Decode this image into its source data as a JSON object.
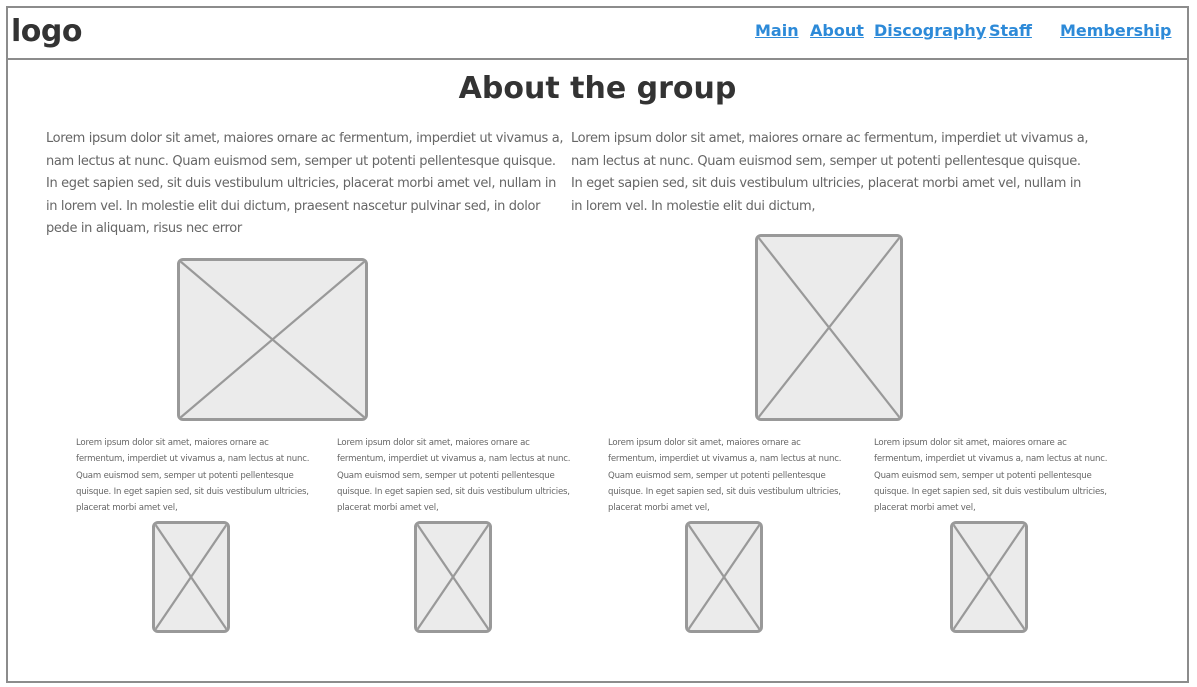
{
  "header": {
    "logo": "logo",
    "nav": [
      "Main",
      "About",
      "Discography",
      "Staff",
      "Membership"
    ]
  },
  "main": {
    "title": "About the group",
    "intro_left": "Lorem ipsum dolor sit amet, maiores ornare ac fermentum, imperdiet ut vivamus a, nam lectus at nunc. Quam euismod sem, semper ut potenti pellentesque quisque. In eget sapien sed, sit duis vestibulum ultricies, placerat morbi amet vel, nullam in in lorem vel. In molestie elit dui dictum, praesent nascetur pulvinar sed, in dolor pede in aliquam, risus nec error",
    "intro_right": "Lorem ipsum dolor sit amet, maiores ornare ac fermentum, imperdiet ut vivamus a, nam lectus at nunc. Quam euismod sem, semper ut potenti pellentesque quisque. In eget sapien sed, sit duis vestibulum ultricies, placerat morbi amet vel, nullam in in lorem vel. In molestie elit dui dictum,",
    "cards": [
      "Lorem ipsum dolor sit amet, maiores ornare ac fermentum, imperdiet ut vivamus a, nam lectus at nunc. Quam euismod sem, semper ut potenti pellentesque quisque. In eget sapien sed, sit duis vestibulum ultricies, placerat morbi amet vel,",
      "Lorem ipsum dolor sit amet, maiores ornare ac fermentum, imperdiet ut vivamus a, nam lectus at nunc. Quam euismod sem, semper ut potenti pellentesque quisque. In eget sapien sed, sit duis vestibulum ultricies, placerat morbi amet vel,",
      "Lorem ipsum dolor sit amet, maiores ornare ac fermentum, imperdiet ut vivamus a, nam lectus at nunc. Quam euismod sem, semper ut potenti pellentesque quisque. In eget sapien sed, sit duis vestibulum ultricies, placerat morbi amet vel,",
      "Lorem ipsum dolor sit amet, maiores ornare ac fermentum, imperdiet ut vivamus a, nam lectus at nunc. Quam euismod sem, semper ut potenti pellentesque quisque. In eget sapien sed, sit duis vestibulum ultricies, placerat morbi amet vel,"
    ]
  },
  "colors": {
    "link": "#2d8ad8",
    "border": "#8c8c8c",
    "placeholder_fill": "#ebebeb",
    "placeholder_stroke": "#999999",
    "text": "#333333",
    "body_text": "#666666"
  }
}
